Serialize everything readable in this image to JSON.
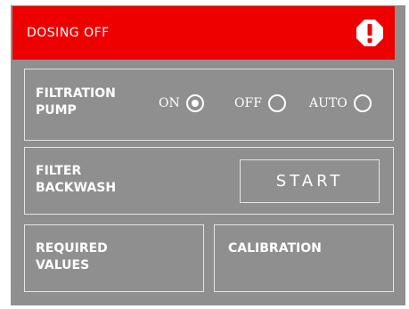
{
  "alert": {
    "text": "DOSING OFF",
    "icon": "exclamation-octagon-icon",
    "color": "#ee0000"
  },
  "filtration_pump": {
    "label_line1": "FILTRATION",
    "label_line2": "PUMP",
    "options": [
      {
        "label": "ON",
        "selected": true
      },
      {
        "label": "OFF",
        "selected": false
      },
      {
        "label": "AUTO",
        "selected": false
      }
    ]
  },
  "filter_backwash": {
    "label_line1": "FILTER",
    "label_line2": "BACKWASH",
    "start_label": "START"
  },
  "required_values": {
    "label_line1": "REQUIRED",
    "label_line2": "VALUES"
  },
  "calibration": {
    "label": "CALIBRATION"
  },
  "colors": {
    "background": "#8f8f8f",
    "border": "#e4e4e4",
    "text": "#ffffff"
  }
}
